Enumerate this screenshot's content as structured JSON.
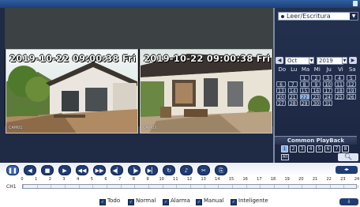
{
  "playback_mode": "Leer/Escritura",
  "video": {
    "tiles": [
      {
        "timestamp": "2019-10-22 09:00:38 Fri",
        "camera": "CAM01"
      },
      {
        "timestamp": "2019-10-22 09:00:38 Fri",
        "camera": "CAM03"
      }
    ]
  },
  "calendar": {
    "month": "Oct",
    "year": "2019",
    "weekdays": [
      "Do",
      "Lu",
      "Ma",
      "Mi",
      "Ju",
      "Vi",
      "Sa"
    ],
    "weeks": [
      [
        "",
        "",
        "1",
        "2",
        "3",
        "4",
        "5"
      ],
      [
        "6",
        "7",
        "8",
        "9",
        "10",
        "11",
        "12"
      ],
      [
        "13",
        "14",
        "15",
        "16",
        "17",
        "18",
        "19"
      ],
      [
        "20",
        "21",
        "22",
        "23",
        "24",
        "25",
        "26"
      ],
      [
        "27",
        "28",
        "29",
        "30",
        "31",
        "",
        ""
      ]
    ],
    "selected_day": "22"
  },
  "common_playback": {
    "title": "Common PlayBack",
    "channels": [
      "1",
      "2",
      "3",
      "4",
      "5",
      "6",
      "7",
      "8"
    ],
    "selected_channels": [
      "1"
    ],
    "all_label": "All"
  },
  "timeline": {
    "channel_label": "CH1",
    "hours": [
      "0",
      "1",
      "2",
      "3",
      "4",
      "5",
      "6",
      "7",
      "8",
      "9",
      "10",
      "11",
      "12",
      "13",
      "14",
      "15",
      "16",
      "17",
      "18",
      "19",
      "20",
      "21",
      "22",
      "23",
      "24"
    ],
    "colors": {
      "normal": "#3fae49",
      "alarm": "#e03c31",
      "motion": "#e6d84a",
      "manual": "#4a86e8"
    }
  },
  "legend": [
    "Todo",
    "Normal",
    "Alarma",
    "Manual",
    "Inteligente"
  ]
}
